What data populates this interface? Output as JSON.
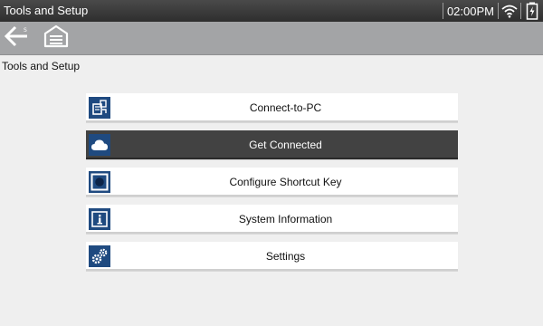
{
  "titlebar": {
    "title": "Tools and Setup",
    "time": "02:00PM",
    "wifi_icon": "wifi-icon",
    "battery_icon": "battery-icon"
  },
  "toolbar": {
    "back_icon": "back-arrow-icon",
    "home_icon": "home-garage-icon"
  },
  "page": {
    "title": "Tools and Setup"
  },
  "menu": {
    "items": [
      {
        "label": "Connect-to-PC",
        "icon": "connect-to-pc-icon",
        "selected": false
      },
      {
        "label": "Get Connected",
        "icon": "cloud-icon",
        "selected": true
      },
      {
        "label": "Configure Shortcut Key",
        "icon": "shortcut-key-icon",
        "selected": false
      },
      {
        "label": "System Information",
        "icon": "info-icon",
        "selected": false
      },
      {
        "label": "Settings",
        "icon": "gears-icon",
        "selected": false
      }
    ]
  },
  "colors": {
    "icon_bg": "#1f4a80",
    "selected_bg": "#424242",
    "toolbar_bg": "#a3a4a6"
  }
}
